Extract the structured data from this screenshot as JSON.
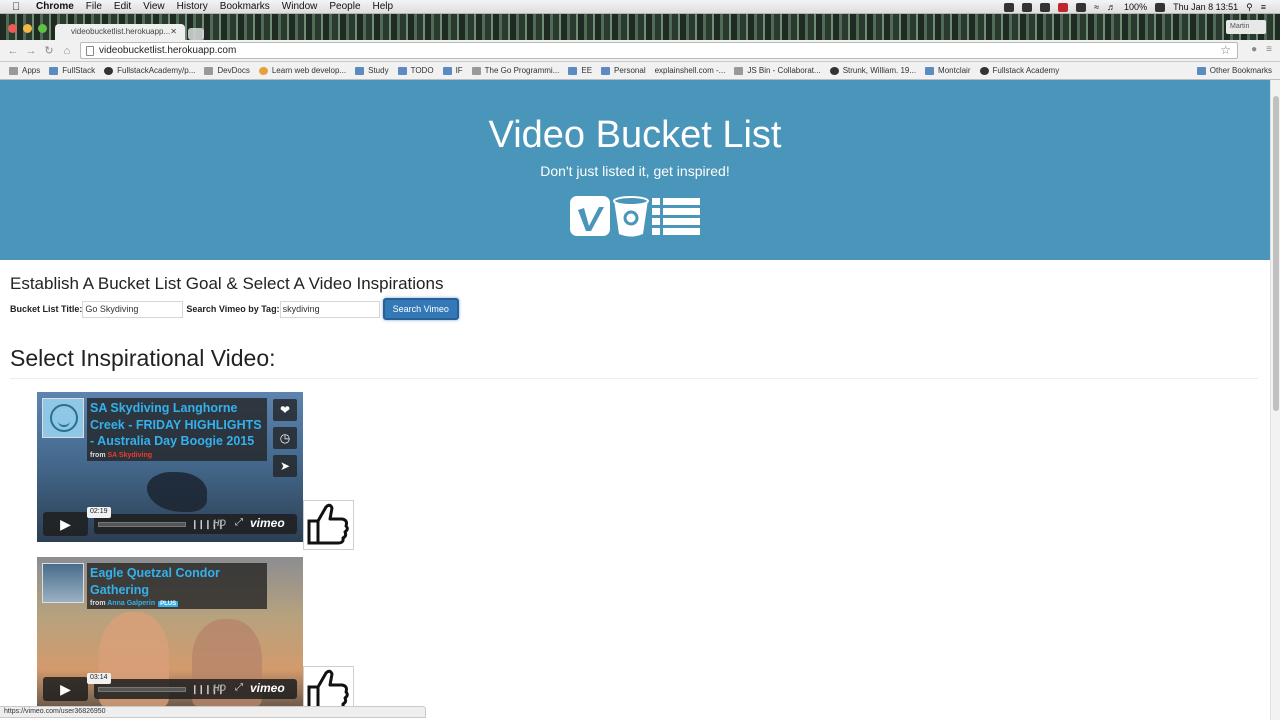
{
  "menubar": {
    "app": "Chrome",
    "menus": [
      "File",
      "Edit",
      "View",
      "History",
      "Bookmarks",
      "Window",
      "People",
      "Help"
    ],
    "battery": "100%",
    "datetime": "Thu Jan 8  13:51"
  },
  "browser": {
    "tab_title": "videobucketlist.herokuapp...",
    "url": "videobucketlist.herokuapp.com",
    "profile": "Martin",
    "bookmarks": [
      "Apps",
      "FullStack",
      "FullstackAcademy/p...",
      "DevDocs",
      "Learn web develop...",
      "Study",
      "TODO",
      "IF",
      "The Go Programmi...",
      "EE",
      "Personal",
      "explainshell.com -...",
      "JS Bin - Collaborat...",
      "Strunk, William. 19...",
      "Montclair",
      "Fullstack Academy"
    ],
    "other_bookmarks": "Other Bookmarks",
    "status_url": "https://vimeo.com/user36826950"
  },
  "hero": {
    "title": "Video Bucket List",
    "subtitle": "Don't just listed it, get inspired!"
  },
  "form": {
    "heading": "Establish A Bucket List Goal & Select A Video Inspirations",
    "title_label": "Bucket List Title:",
    "title_value": "Go Skydiving",
    "tag_label": "Search Vimeo by Tag:",
    "tag_value": "skydiving",
    "search_button": "Search Vimeo"
  },
  "videos_heading": "Select Inspirational Video:",
  "videos": [
    {
      "title": "SA Skydiving Langhorne Creek - FRIDAY HIGHLIGHTS - Australia Day Boogie 2015",
      "from_label": "from",
      "author": "SA Skydiving",
      "duration": "02:19",
      "hd": "HD",
      "brand": "vimeo"
    },
    {
      "title": "Eagle Quetzal Condor Gathering",
      "from_label": "from",
      "author": "Anna Galperin",
      "badge": "PLUS",
      "duration": "03:14",
      "hd": "HD",
      "brand": "vimeo"
    }
  ],
  "colors": {
    "hero": "#4a95ba",
    "button": "#3479b7",
    "vimeo_title": "#34b1ec"
  }
}
